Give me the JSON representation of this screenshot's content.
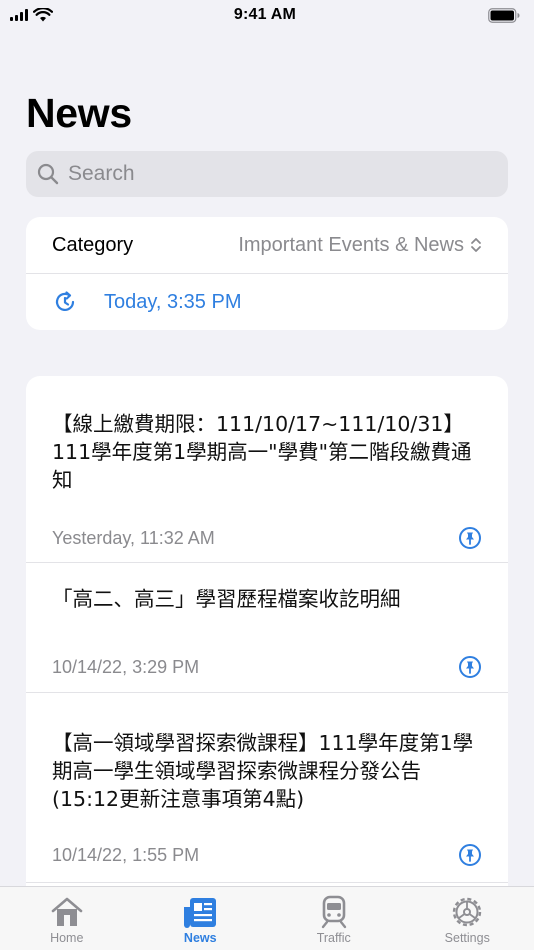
{
  "status_bar": {
    "time": "9:41 AM"
  },
  "header": {
    "title": "News"
  },
  "search": {
    "placeholder": "Search"
  },
  "filter": {
    "category_label": "Category",
    "category_value": "Important Events & News",
    "updated_label": "Today, 3:35 PM"
  },
  "news": [
    {
      "title": "【線上繳費期限：111/10/17~111/10/31】111學年度第1學期高一\"學費\"第二階段繳費通知",
      "date": "Yesterday, 11:32 AM",
      "pinned": true
    },
    {
      "title": "「高二、高三」學習歷程檔案收訖明細",
      "date": "10/14/22, 3:29 PM",
      "pinned": true
    },
    {
      "title": "【高一領域學習探索微課程】111學年度第1學期高一學生領域學習探索微課程分發公告(15:12更新注意事項第4點)",
      "date": "10/14/22, 1:55 PM",
      "pinned": true
    }
  ],
  "tabs": [
    {
      "label": "Home",
      "icon": "house-icon",
      "active": false
    },
    {
      "label": "News",
      "icon": "newspaper-icon",
      "active": true
    },
    {
      "label": "Traffic",
      "icon": "train-icon",
      "active": false
    },
    {
      "label": "Settings",
      "icon": "gear-icon",
      "active": false
    }
  ],
  "colors": {
    "accent": "#2f7fe0",
    "background": "#f2f2f7",
    "secondary_text": "#8a8a8e"
  }
}
